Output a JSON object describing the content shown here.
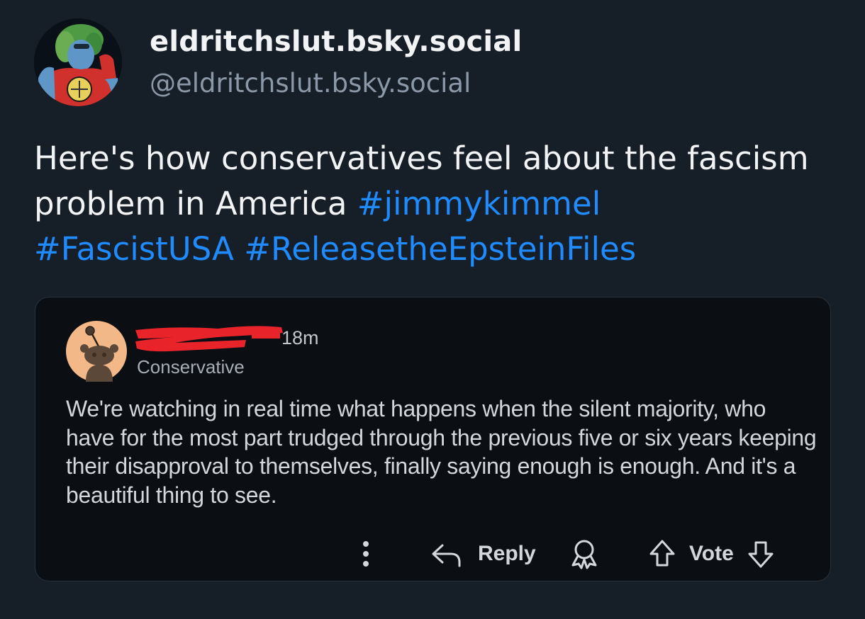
{
  "author": {
    "display_name": "eldritchslut.bsky.social",
    "handle": "@eldritchslut.bsky.social"
  },
  "post": {
    "text_plain": "Here's how conservatives feel about the fascism problem in America ",
    "hashtags": [
      "#jimmykimmel",
      "#FascistUSA",
      "#ReleasetheEpsteinFiles"
    ]
  },
  "embed": {
    "time": "18m",
    "subreddit": "Conservative",
    "comment": "We're watching in real time what happens when the silent majority, who have for the most part trudged through the previous five or six years keeping their disapproval to themselves, finally saying enough is enough. And it's a beautiful thing to see.",
    "actions": {
      "more_icon": "vertical-ellipsis-icon",
      "reply_label": "Reply",
      "award_icon": "award-icon",
      "vote_label": "Vote"
    }
  },
  "colors": {
    "background": "#161e27",
    "text": "#f1f3f5",
    "handle": "#8b98a8",
    "hashtag": "#208bfe",
    "embed_background": "#0b0e12",
    "redaction": "#e8232a"
  }
}
